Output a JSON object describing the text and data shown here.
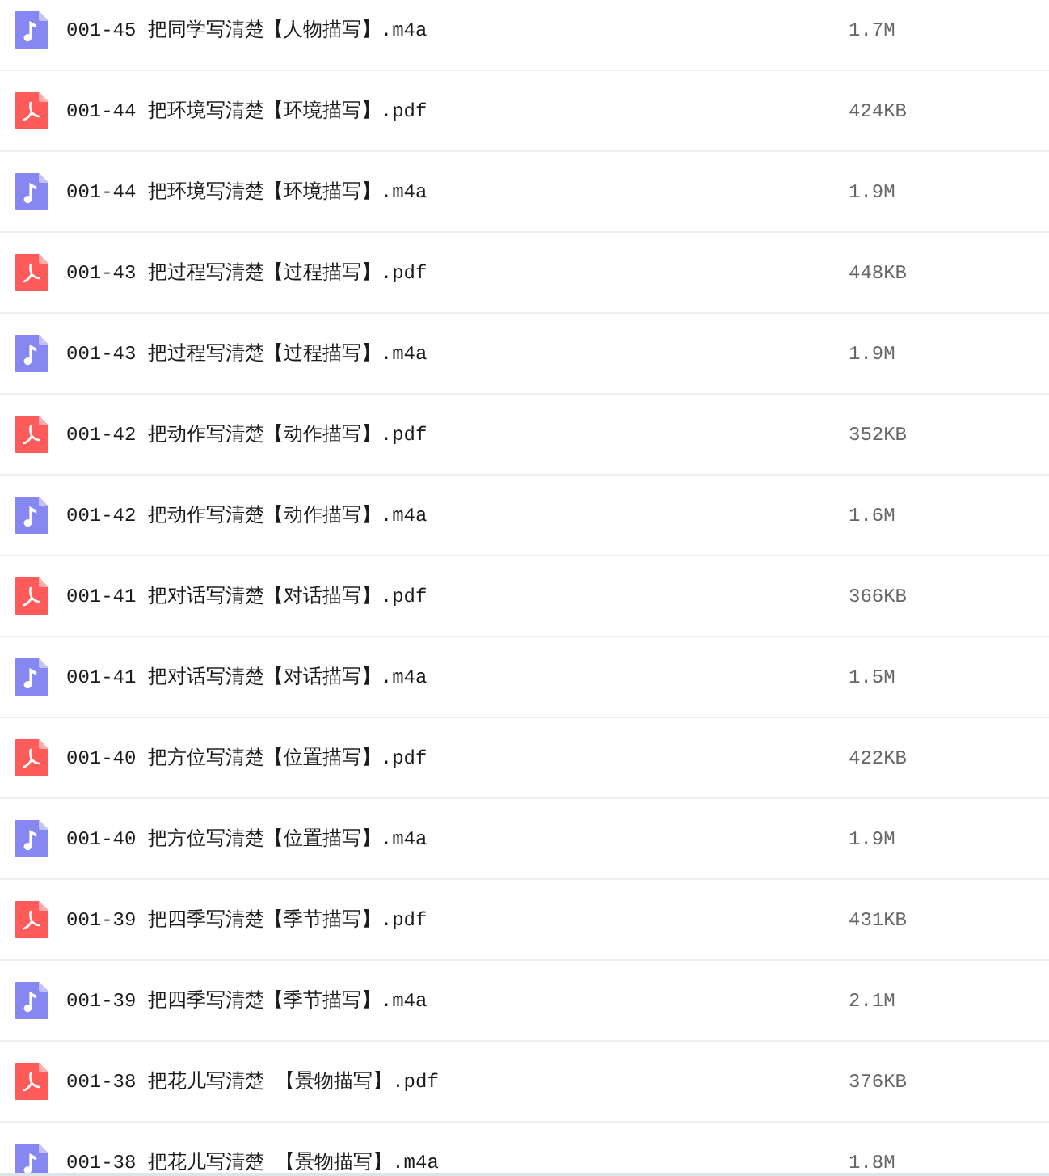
{
  "files": [
    {
      "kind": "audio",
      "name": "001-45 把同学写清楚【人物描写】.m4a",
      "size": "1.7M"
    },
    {
      "kind": "pdf",
      "name": "001-44 把环境写清楚【环境描写】.pdf",
      "size": "424KB"
    },
    {
      "kind": "audio",
      "name": "001-44 把环境写清楚【环境描写】.m4a",
      "size": "1.9M"
    },
    {
      "kind": "pdf",
      "name": "001-43 把过程写清楚【过程描写】.pdf",
      "size": "448KB"
    },
    {
      "kind": "audio",
      "name": "001-43 把过程写清楚【过程描写】.m4a",
      "size": "1.9M"
    },
    {
      "kind": "pdf",
      "name": "001-42 把动作写清楚【动作描写】.pdf",
      "size": "352KB"
    },
    {
      "kind": "audio",
      "name": "001-42 把动作写清楚【动作描写】.m4a",
      "size": "1.6M"
    },
    {
      "kind": "pdf",
      "name": "001-41 把对话写清楚【对话描写】.pdf",
      "size": "366KB"
    },
    {
      "kind": "audio",
      "name": "001-41 把对话写清楚【对话描写】.m4a",
      "size": "1.5M"
    },
    {
      "kind": "pdf",
      "name": "001-40 把方位写清楚【位置描写】.pdf",
      "size": "422KB"
    },
    {
      "kind": "audio",
      "name": "001-40 把方位写清楚【位置描写】.m4a",
      "size": "1.9M"
    },
    {
      "kind": "pdf",
      "name": "001-39 把四季写清楚【季节描写】.pdf",
      "size": "431KB"
    },
    {
      "kind": "audio",
      "name": "001-39 把四季写清楚【季节描写】.m4a",
      "size": "2.1M"
    },
    {
      "kind": "pdf",
      "name": "001-38 把花儿写清楚 【景物描写】.pdf",
      "size": "376KB"
    },
    {
      "kind": "audio",
      "name": "001-38 把花儿写清楚 【景物描写】.m4a",
      "size": "1.8M"
    }
  ]
}
